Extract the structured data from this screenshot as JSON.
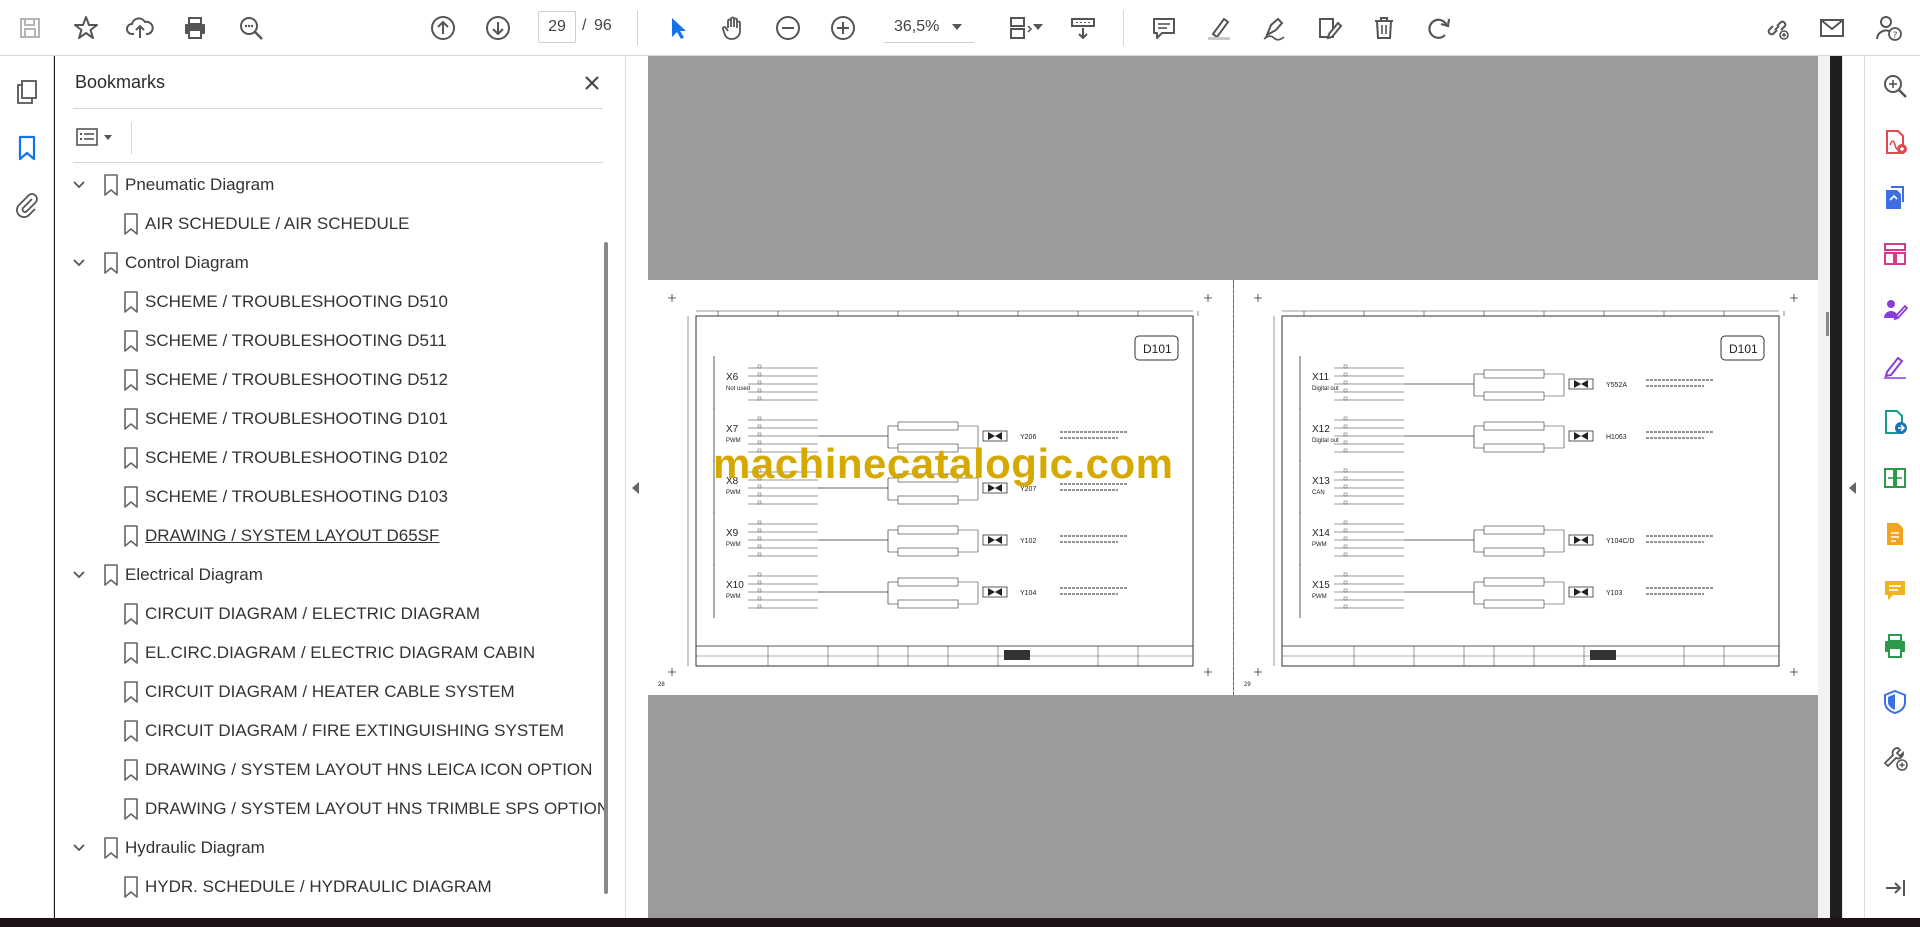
{
  "toolbar": {
    "current_page": "29",
    "page_separator": "/",
    "total_pages": "96",
    "zoom": "36,5%"
  },
  "panel": {
    "title": "Bookmarks"
  },
  "bookmarks": [
    {
      "label": "Pneumatic Diagram",
      "level": 0,
      "expanded": true
    },
    {
      "label": "AIR SCHEDULE / AIR SCHEDULE",
      "level": 1
    },
    {
      "label": "Control Diagram",
      "level": 0,
      "expanded": true
    },
    {
      "label": "SCHEME / TROUBLESHOOTING D510",
      "level": 1
    },
    {
      "label": "SCHEME / TROUBLESHOOTING D511",
      "level": 1
    },
    {
      "label": "SCHEME / TROUBLESHOOTING D512",
      "level": 1
    },
    {
      "label": "SCHEME / TROUBLESHOOTING D101",
      "level": 1
    },
    {
      "label": "SCHEME / TROUBLESHOOTING D102",
      "level": 1
    },
    {
      "label": "SCHEME / TROUBLESHOOTING D103",
      "level": 1
    },
    {
      "label": "DRAWING / SYSTEM LAYOUT D65SF",
      "level": 1,
      "hovered": true
    },
    {
      "label": "Electrical Diagram",
      "level": 0,
      "expanded": true
    },
    {
      "label": "CIRCUIT DIAGRAM / ELECTRIC DIAGRAM",
      "level": 1
    },
    {
      "label": "EL.CIRC.DIAGRAM / ELECTRIC DIAGRAM CABIN",
      "level": 1
    },
    {
      "label": "CIRCUIT DIAGRAM / HEATER CABLE SYSTEM",
      "level": 1
    },
    {
      "label": "CIRCUIT DIAGRAM / FIRE EXTINGUISHING SYSTEM",
      "level": 1
    },
    {
      "label": "DRAWING / SYSTEM LAYOUT HNS LEICA ICON OPTION",
      "level": 1
    },
    {
      "label": "DRAWING / SYSTEM LAYOUT HNS TRIMBLE SPS OPTION",
      "level": 1
    },
    {
      "label": "Hydraulic Diagram",
      "level": 0,
      "expanded": true
    },
    {
      "label": "HYDR. SCHEDULE / HYDRAULIC DIAGRAM",
      "level": 1
    }
  ],
  "document": {
    "left_page": {
      "badge": "D101",
      "page_no": "28",
      "connectors": [
        {
          "id": "X6",
          "sub": "Not used",
          "valve": ""
        },
        {
          "id": "X7",
          "sub": "PWM",
          "valve": "Y206"
        },
        {
          "id": "X8",
          "sub": "PWM",
          "valve": "Y207"
        },
        {
          "id": "X9",
          "sub": "PWM",
          "valve": "Y102"
        },
        {
          "id": "X10",
          "sub": "PWM",
          "valve": "Y104"
        }
      ]
    },
    "right_page": {
      "badge": "D101",
      "page_no": "29",
      "connectors": [
        {
          "id": "X11",
          "sub": "Digital out",
          "valve": "Y552A"
        },
        {
          "id": "X12",
          "sub": "Digital out",
          "valve": "H1063"
        },
        {
          "id": "X13",
          "sub": "CAN",
          "valve": ""
        },
        {
          "id": "X14",
          "sub": "PWM",
          "valve": "Y104C/D"
        },
        {
          "id": "X15",
          "sub": "PWM",
          "valve": "Y103"
        }
      ]
    },
    "watermark": "machinecatalogic.com"
  },
  "colors": {
    "accent_blue": "#1473e6",
    "doc_bg": "#9b9b9b",
    "watermark": "#d6a900",
    "tool_purple": "#8a3dd6",
    "tool_red": "#e34850"
  }
}
